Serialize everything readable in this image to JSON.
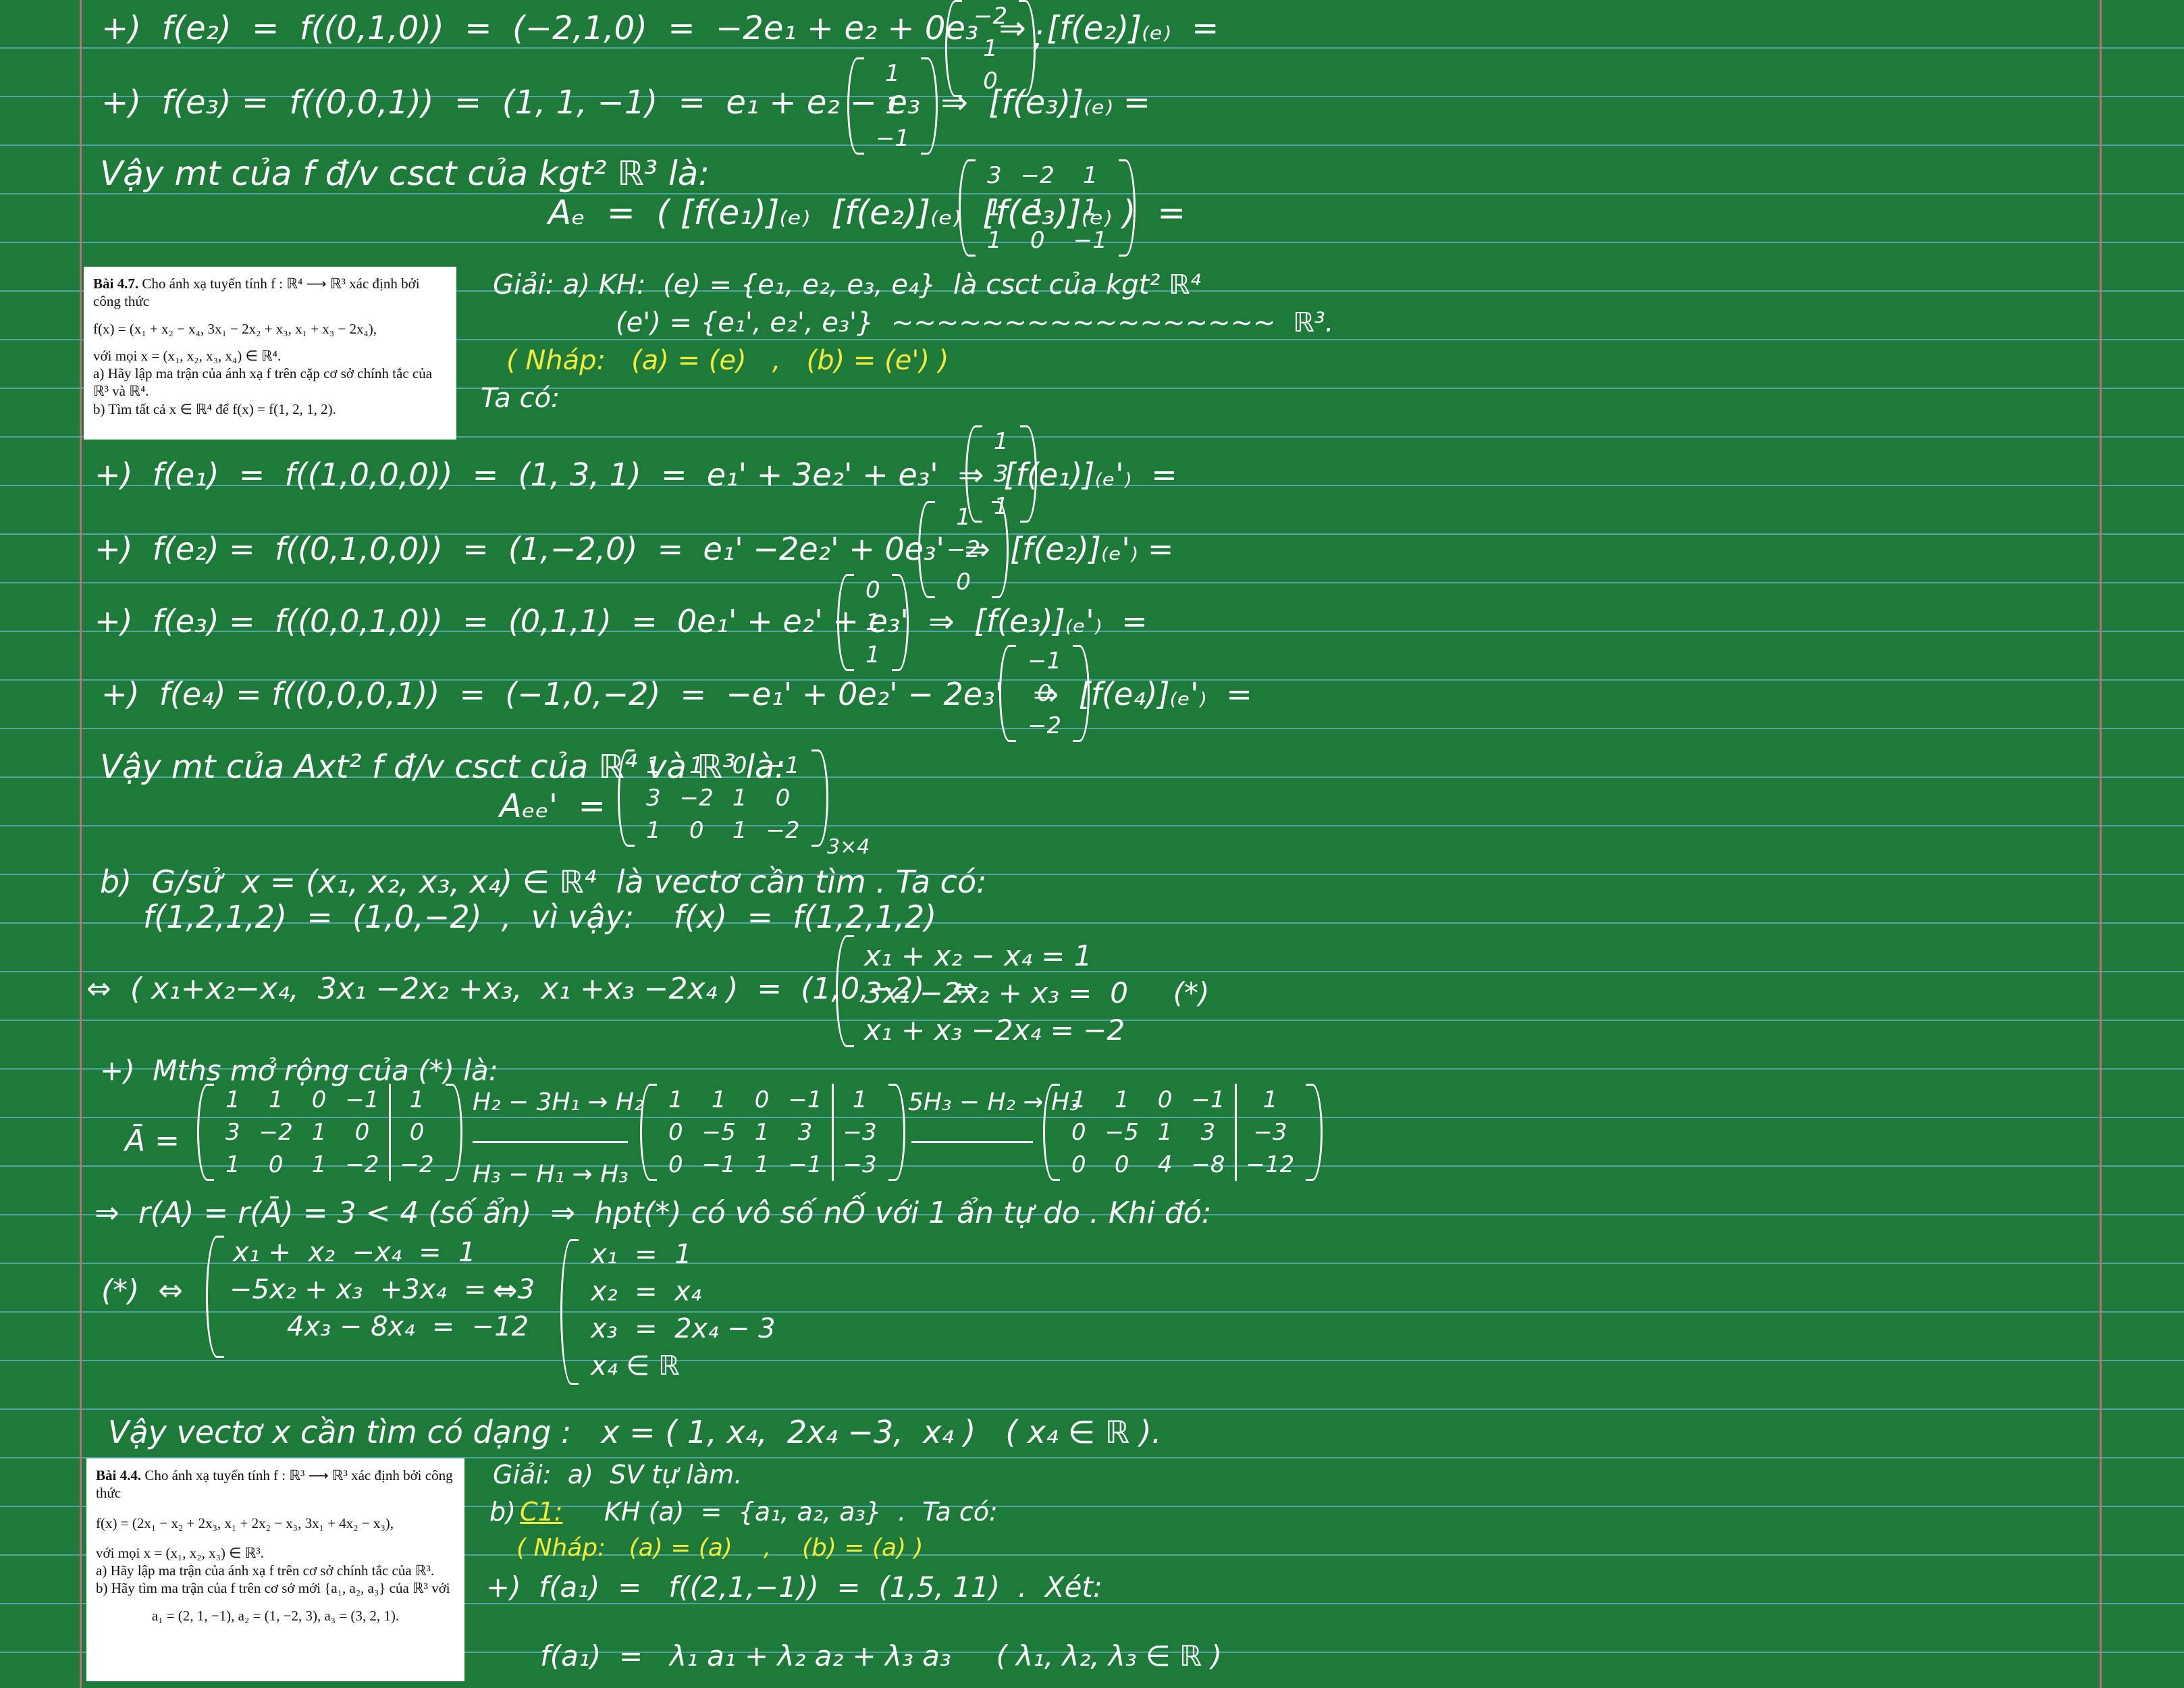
{
  "lines": {
    "l1": "+)  f(e₂)  =  f((0,1,0))  =  (−2,1,0)  =  −2e₁ + e₂ + 0e₃  ⇒  [f(e₂)]₍ₑ₎  =",
    "l1_end": ";",
    "l2": "+)  f(e₃) =  f((0,0,1))  =  (1, 1, −1)  =  e₁ + e₂ − e₃  ⇒  [f(e₃)]₍ₑ₎ =",
    "l3": "Vậy mt của f đ/v csct của kgt² ℝ³ là:",
    "l4": "Aₑ  =  ( [f(e₁)]₍ₑ₎  [f(e₂)]₍ₑ₎  [f(e₃)]₍ₑ₎ )  =",
    "giai1a": "Giải: a) KH:  (e) = {e₁, e₂, e₃, e₄}  là csct của kgt² ℝ⁴",
    "giai1b": "(e') = {e₁', e₂', e₃'}  ~~~~~~~~~~~~~~~~~  ℝ³.",
    "nhap1": "( Nháp:   (a) = (e)   ,   (b) = (e') )",
    "taco1": "Ta có:",
    "m1": "+)  f(e₁)  =  f((1,0,0,0))  =  (1, 3, 1)  =  e₁' + 3e₂' + e₃'  ⇒  [f(e₁)]₍ₑ'₎  =",
    "m2": "+)  f(e₂) =  f((0,1,0,0))  =  (1,−2,0)  =  e₁' −2e₂' + 0e₃'  ⇒  [f(e₂)]₍ₑ'₎ =",
    "m3": "+)  f(e₃) =  f((0,0,1,0))  =  (0,1,1)  =  0e₁' + e₂' + e₃'  ⇒  [f(e₃)]₍ₑ'₎  =",
    "m4": "+)  f(e₄) = f((0,0,0,1))  =  (−1,0,−2)  =  −e₁' + 0e₂' − 2e₃'   ⇒  [f(e₄)]₍ₑ'₎  =",
    "v2": "Vậy mt của Axt² f đ/v csct của ℝ⁴ và ℝ³ là:",
    "aee": "Aₑₑ'  =",
    "dim": "3×4",
    "b1": "b)  G/sử  x = (x₁, x₂, x₃, x₄) ∈ ℝ⁴  là vectơ cần tìm . Ta có:",
    "b2": "f(1,2,1,2)  =  (1,0,−2)  ,  vì vậy:    f(x)  =  f(1,2,1,2)",
    "b3": "⇔  ( x₁+x₂−x₄,  3x₁ −2x₂ +x₃,  x₁ +x₃ −2x₄ )  =  (1,0,−2)   ⇔",
    "s1": "x₁ + x₂ − x₄ = 1",
    "s2": "3x₁ −2x₂ + x₃ =  0     (*)",
    "s3": "x₁ + x₃ −2x₄ = −2",
    "mthsmr": "+)  Mths mở rộng của (*) là:",
    "abar": "Ā =",
    "op1": "H₂ − 3H₁ → H₂",
    "op2": "H₃ − H₁ → H₃",
    "op3": "5H₃ − H₂ → H₃",
    "rank": "⇒  r(A) = r(Ā) = 3 < 4 (số ẩn)  ⇒  hpt(*) có vô số nỐ với 1 ẩn tự do . Khi đó:",
    "star": "(*)  ⇔",
    "t1": "x₁ +  x₂  −x₄  =  1",
    "t2": "−5x₂ + x₃  +3x₄  = −3",
    "t3": "4x₃ − 8x₄  =  −12",
    "eqv": "⇔",
    "r1": "x₁  =  1",
    "r2": "x₂  =  x₄",
    "r3": "x₃  =  2x₄ − 3",
    "r4": "x₄ ∈ ℝ",
    "vay3": "Vậy vectơ x cần tìm có dạng :   x = ( 1, x₄,  2x₄ −3,  x₄ )   ( x₄ ∈ ℝ ).",
    "g2a": "Giải:  a)  SV tự làm.",
    "g2b_pre": "b)",
    "g2b_c1": "C1:",
    "g2b": "KH (a)  =  {a₁, a₂, a₃}  .  Ta có:",
    "nhap2": "( Nháp:   (a) = (a)    ,    (b) = (a) )",
    "fa1": "+)  f(a₁)  =   f((2,1,−1))  =  (1,5, 11)  .  Xét:",
    "fa1b": "f(a₁)  =   λ₁ a₁ + λ₂ a₂ + λ₃ a₃     ( λ₁, λ₂, λ₃ ∈ ℝ )"
  },
  "matrices": {
    "fe2": [
      [
        "−2"
      ],
      [
        "1"
      ],
      [
        "0"
      ]
    ],
    "fe3": [
      [
        "1"
      ],
      [
        "1"
      ],
      [
        "−1"
      ]
    ],
    "Ae": [
      [
        "3",
        "−2",
        "1"
      ],
      [
        "1",
        "1",
        "1"
      ],
      [
        "1",
        "0",
        "−1"
      ]
    ],
    "fe1p": [
      [
        "1"
      ],
      [
        "3"
      ],
      [
        "1"
      ]
    ],
    "fe2p": [
      [
        "1"
      ],
      [
        "−2"
      ],
      [
        "0"
      ]
    ],
    "fe3p": [
      [
        "0"
      ],
      [
        "1"
      ],
      [
        "1"
      ]
    ],
    "fe4p": [
      [
        "−1"
      ],
      [
        "0"
      ],
      [
        "−2"
      ]
    ],
    "Aee": [
      [
        "1",
        "1",
        "0",
        "−1"
      ],
      [
        "3",
        "−2",
        "1",
        "0"
      ],
      [
        "1",
        "0",
        "1",
        "−2"
      ]
    ],
    "aug1": [
      [
        "1",
        "1",
        "0",
        "−1",
        "1"
      ],
      [
        "3",
        "−2",
        "1",
        "0",
        "0"
      ],
      [
        "1",
        "0",
        "1",
        "−2",
        "−2"
      ]
    ],
    "aug2": [
      [
        "1",
        "1",
        "0",
        "−1",
        "1"
      ],
      [
        "0",
        "−5",
        "1",
        "3",
        "−3"
      ],
      [
        "0",
        "−1",
        "1",
        "−1",
        "−3"
      ]
    ],
    "aug3": [
      [
        "1",
        "1",
        "0",
        "−1",
        "1"
      ],
      [
        "0",
        "−5",
        "1",
        "3",
        "−3"
      ],
      [
        "0",
        "0",
        "4",
        "−8",
        "−12"
      ]
    ]
  },
  "problem47": {
    "title": "Bài 4.7.",
    "line1": "Cho ánh xạ tuyến tính f : ℝ⁴ ⟶ ℝ³ xác định bởi công thức",
    "formula": "f(x) = (x₁ + x₂ − x₄, 3x₁ − 2x₂ + x₃, x₁ + x₃ − 2x₄),",
    "line2": "với mọi x = (x₁, x₂, x₃, x₄) ∈ ℝ⁴.",
    "line3": "a) Hãy lập ma trận của ánh xạ f trên cặp cơ sở chính tắc của ℝ³ và ℝ⁴.",
    "line4": "b) Tìm tất cả x ∈ ℝ⁴ để f(x) = f(1, 2, 1, 2)."
  },
  "problem44": {
    "title": "Bài 4.4.",
    "line1": "Cho ánh xạ tuyến tính f : ℝ³ ⟶ ℝ³ xác định bởi công thức",
    "formula": "f(x) = (2x₁ − x₂ + 2x₃, x₁ + 2x₂ − x₃, 3x₁ + 4x₂ − x₃),",
    "line2": "với mọi x = (x₁, x₂, x₃) ∈ ℝ³.",
    "line3": "a) Hãy lập ma trận của ánh xạ f trên cơ sở chính tắc của ℝ³.",
    "line4": "b) Hãy tìm ma trận của f trên cơ sở mới {a₁, a₂, a₃} của ℝ³ với",
    "line5": "a₁ = (2, 1, −1),  a₂ = (1, −2, 3),  a₃ = (3, 2, 1)."
  }
}
